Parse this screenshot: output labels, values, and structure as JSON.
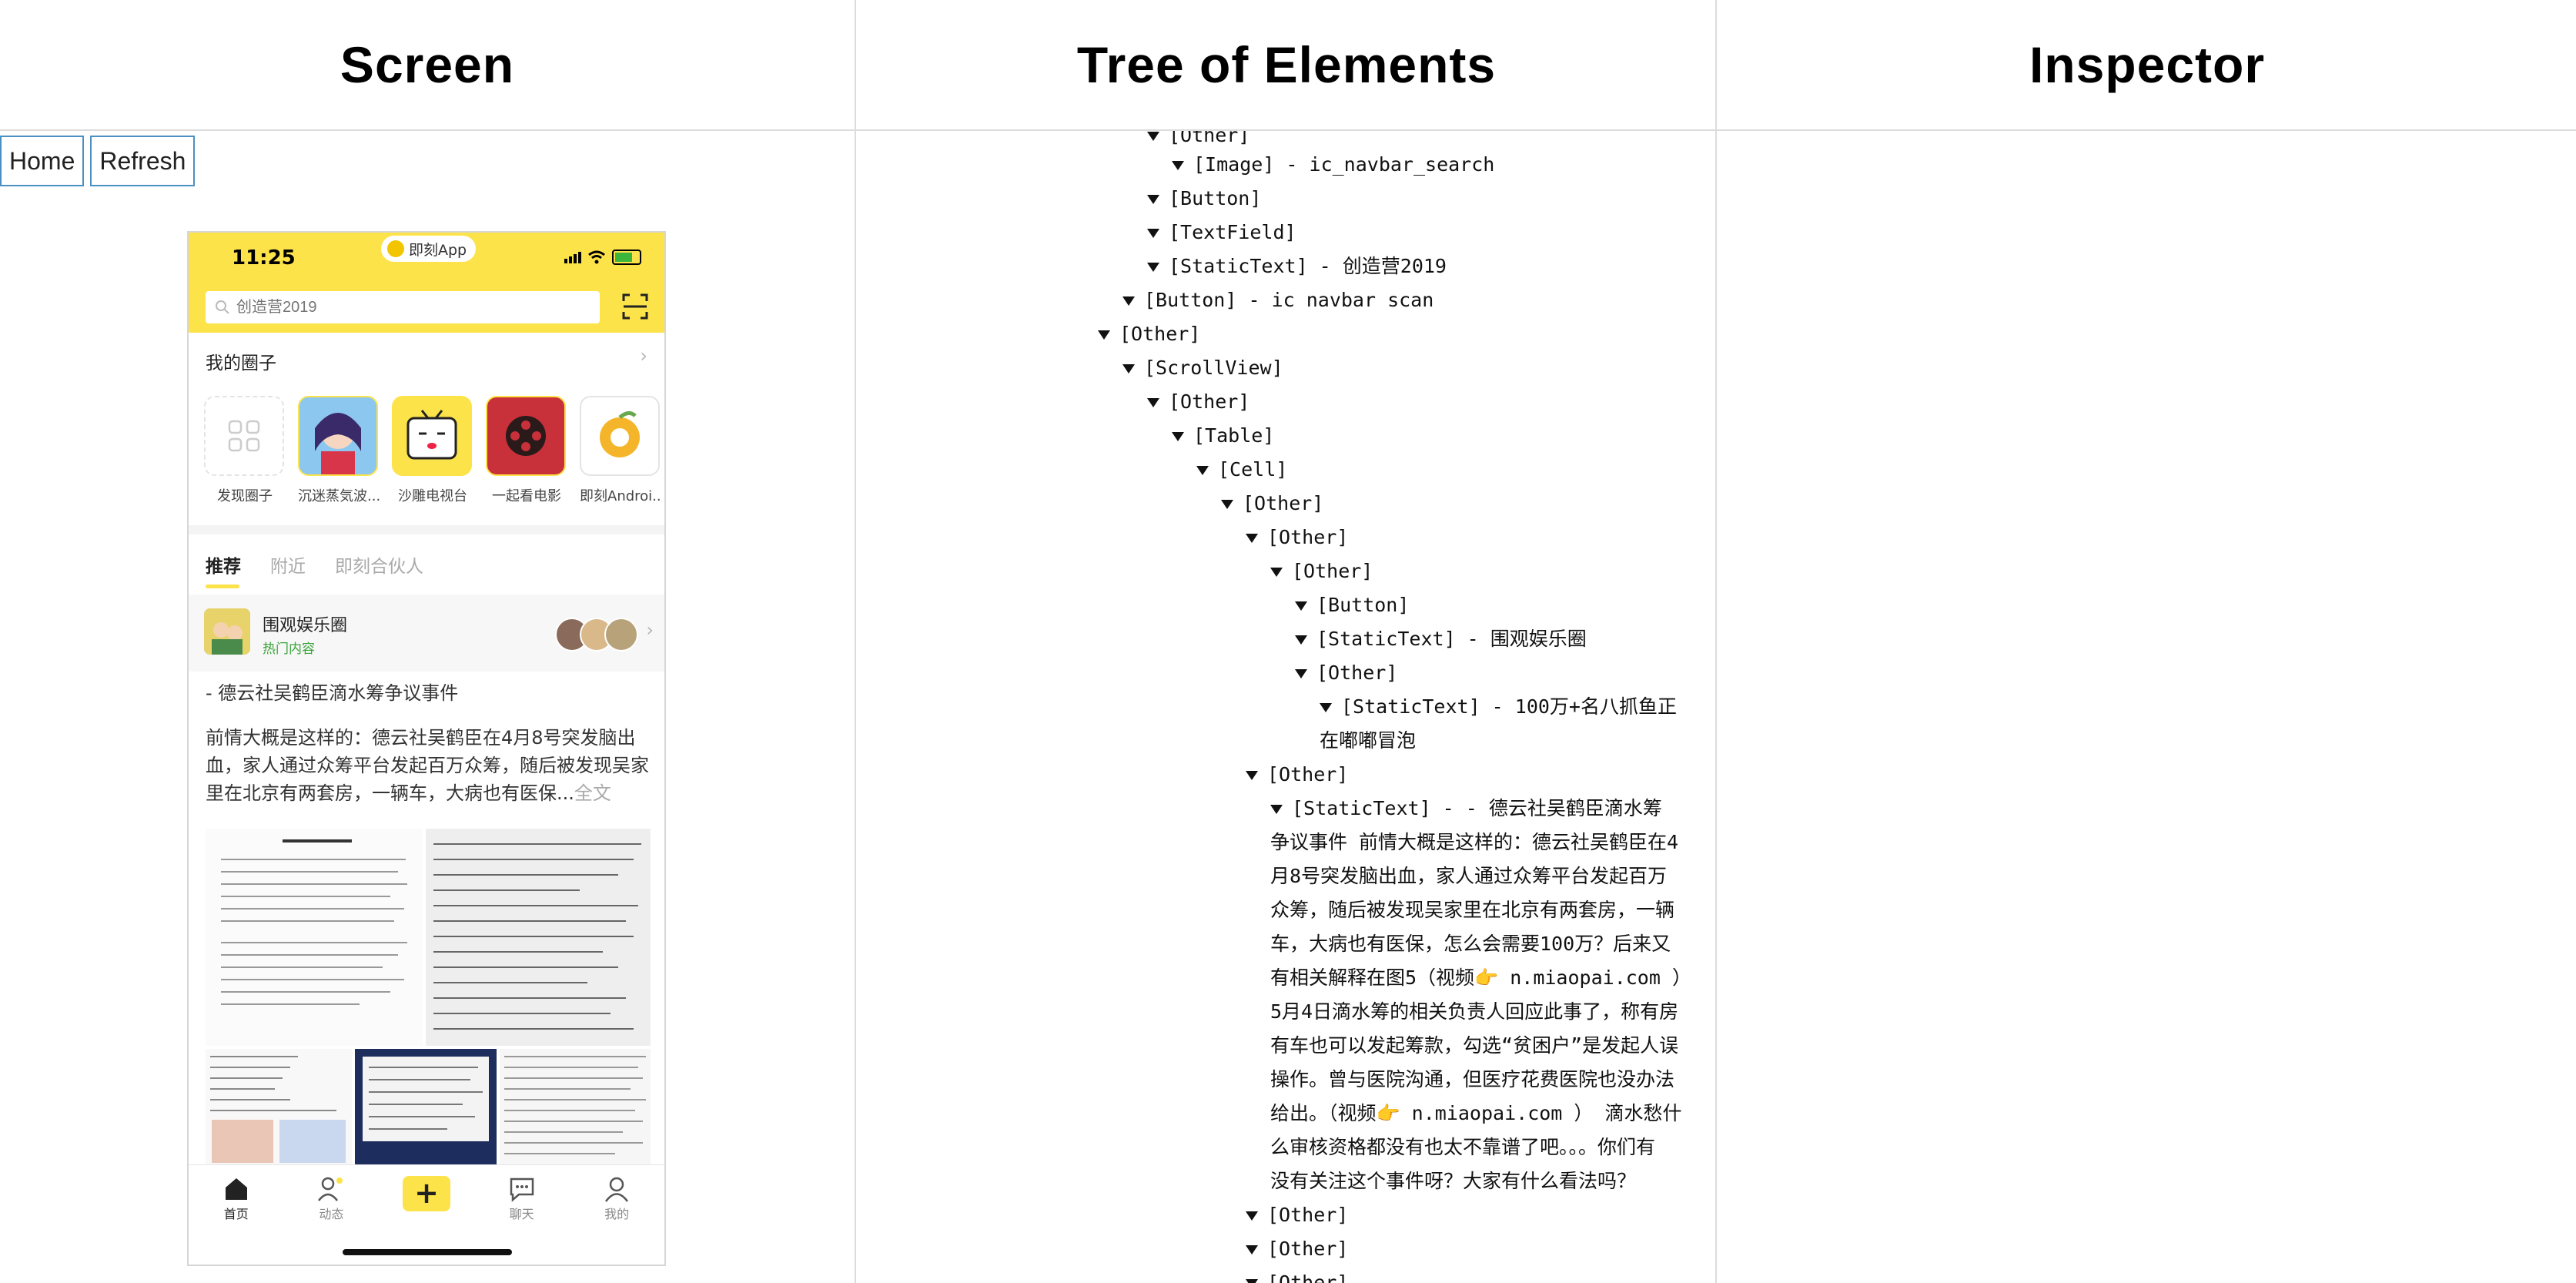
{
  "headers": {
    "screen": "Screen",
    "tree": "Tree of Elements",
    "inspector": "Inspector"
  },
  "buttons": {
    "home": "Home",
    "refresh": "Refresh"
  },
  "phone": {
    "status_time": "11:25",
    "app_pill": "即刻App",
    "search_placeholder": "创造营2019",
    "circles_title": "我的圈子",
    "circles": [
      {
        "label": "发现圈子",
        "icon": "grid-icon"
      },
      {
        "label": "沉迷蒸気波...",
        "icon": "anime-icon"
      },
      {
        "label": "沙雕电视台",
        "icon": "tv-face-icon"
      },
      {
        "label": "一起看电影",
        "icon": "film-reel-icon"
      },
      {
        "label": "即刻Androi...",
        "icon": "android-icon"
      }
    ],
    "tabs": [
      "推荐",
      "附近",
      "即刻合伙人"
    ],
    "feed_title": "围观娱乐圈",
    "feed_subtitle": "热门内容",
    "post_headline": "- 德云社吴鹤臣滴水筹争议事件",
    "post_text": "前情大概是这样的：德云社吴鹤臣在4月8号突发脑出血，家人通过众筹平台发起百万众筹，随后被发现吴家里在北京有两套房，一辆车，大病也有医保...",
    "post_more": "全文",
    "tabbar": [
      "首页",
      "动态",
      "",
      "聊天",
      "我的"
    ],
    "tabbar_plus": "+"
  },
  "tree": {
    "nodes": [
      "[Other]",
      "[Image] - ic_navbar_search",
      "[Button]",
      "[TextField]",
      "[StaticText] - 创造营2019",
      "[Button] - ic navbar scan",
      "[Other]",
      "[ScrollView]",
      "[Other]",
      "[Table]",
      "[Cell]",
      "[Other]",
      "[Other]",
      "[Other]",
      "[Button]",
      "[StaticText] - 围观娱乐圈",
      "[Other]",
      "[StaticText] - 100万+名八抓鱼正",
      "在嘟嘟冒泡",
      "[Other]",
      "[StaticText] - - 德云社吴鹤臣滴水筹",
      "[Other]",
      "[Other]",
      "[Other]"
    ],
    "long_text": [
      "争议事件  前情大概是这样的：德云社吴鹤臣在4",
      "月8号突发脑出血，家人通过众筹平台发起百万",
      "众筹，随后被发现吴家里在北京有两套房，一辆",
      "车，大病也有医保，怎么会需要100万？后来又",
      "有相关解释在图5（视频👉 n.miaopai.com ）",
      "5月4日滴水筹的相关负责人回应此事了，称有房",
      "有车也可以发起筹款，勾选“贫困户”是发起人误",
      "操作。曾与医院沟通，但医疗花费医院也没办法",
      "给出。（视频👉 n.miaopai.com ）  滴水愁什",
      "么审核资格都没有也太不靠谱了吧。。。你们有",
      "没有关注这个事件呀？大家有什么看法吗？"
    ]
  }
}
